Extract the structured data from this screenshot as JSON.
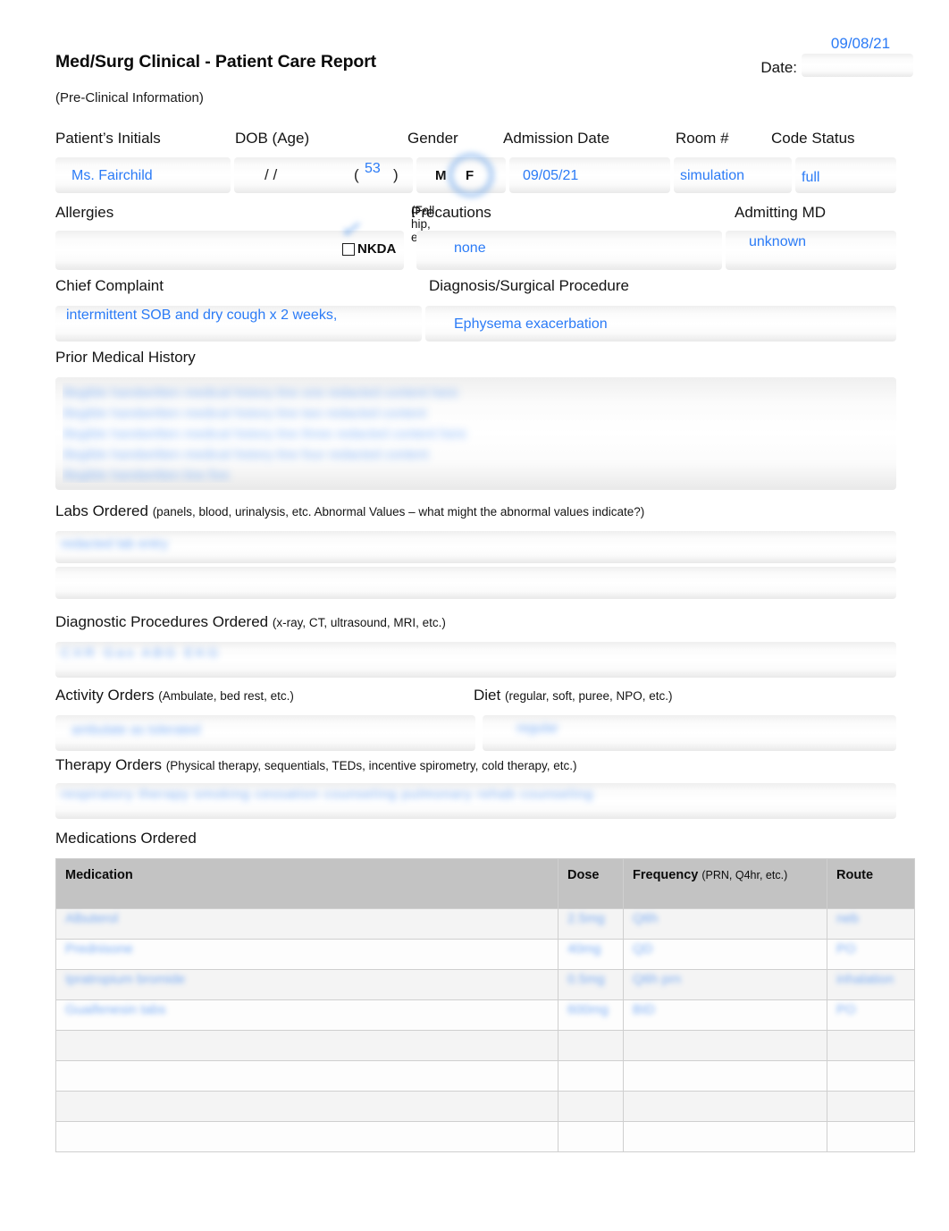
{
  "header": {
    "title": "Med/Surg Clinical - Patient Care Report",
    "subtitle": "(Pre-Clinical Information)",
    "date_label": "Date:",
    "date_value": "09/08/21"
  },
  "colors": {
    "handwriting_blue": "#2b7bf6",
    "table_header_gray": "#c3c3c3",
    "text_black": "#111111"
  },
  "identity": {
    "labels": {
      "initials": "Patient’s Initials",
      "dob": "DOB (Age)",
      "gender": "Gender",
      "admission": "Admission Date",
      "room": "Room #",
      "code_status": "Code Status"
    },
    "initials_value": "Ms. Fairchild",
    "dob_value": "/        /",
    "age_open_paren": "(",
    "age_value": "53",
    "age_close_paren": ")",
    "gender_options": [
      "M",
      "F"
    ],
    "gender_selected": "F",
    "admission_value": "09/05/21",
    "room_value": "simulation",
    "code_status_value": "full"
  },
  "allergies_row": {
    "labels": {
      "allergies": "Allergies",
      "precautions": "Precautions",
      "precautions_hint": "(Fall, hip, etc.)",
      "admitting_md": "Admitting MD"
    },
    "allergies_value": "",
    "nkda_label": "NKDA",
    "nkda_checked": true,
    "precautions_value": "none",
    "admitting_md_value": "unknown"
  },
  "complaint_row": {
    "labels": {
      "chief_complaint": "Chief Complaint",
      "diagnosis": "Diagnosis/Surgical Procedure"
    },
    "chief_complaint_value": "intermittent SOB and dry cough x 2 weeks,",
    "diagnosis_value": "Ephysema exacerbation"
  },
  "sections": [
    {
      "name": "prior-medical-history",
      "label": "Prior Medical History",
      "hint": "",
      "redacted": true,
      "lines": [
        "illegible handwritten medical history line one redacted content here",
        "illegible handwritten medical history line two redacted content",
        "illegible handwritten medical history line three redacted content here",
        "illegible handwritten medical history line four redacted content",
        "illegible handwritten line five"
      ]
    },
    {
      "name": "labs-ordered",
      "label": "Labs Ordered",
      "hint": "(panels, blood, urinalysis, etc. Abnormal Values  –  what might the abnormal values indicate?)",
      "redacted": true,
      "lines": [
        "redacted lab entry",
        ""
      ]
    },
    {
      "name": "diagnostic-procedures-ordered",
      "label": "Diagnostic Procedures Ordered",
      "hint": "(x-ray, CT, ultrasound, MRI, etc.)",
      "redacted": true,
      "lines": [
        "CXR  Gas  ABG  EKG"
      ]
    },
    {
      "name": "therapy-orders",
      "label": "Therapy Orders",
      "hint": "(Physical therapy, sequentials, TEDs, incentive spirometry, cold therapy, etc.)",
      "redacted": true,
      "lines": [
        "respiratory therapy  smoking cessation counseling  pulmonary rehab counseling"
      ]
    }
  ],
  "activity_diet": {
    "activity_label": "Activity Orders",
    "activity_hint": "(Ambulate, bed rest, etc.)",
    "activity_value_redacted": "ambulate as tolerated",
    "diet_label": "Diet",
    "diet_hint": "(regular, soft, puree, NPO, etc.)",
    "diet_value_redacted": "regular"
  },
  "medications": {
    "section_label": "Medications Ordered",
    "columns": [
      {
        "key": "medication",
        "label": "Medication",
        "hint": ""
      },
      {
        "key": "dose",
        "label": "Dose",
        "hint": ""
      },
      {
        "key": "frequency",
        "label": "Frequency",
        "hint": "(PRN, Q4hr, etc.)"
      },
      {
        "key": "route",
        "label": "Route",
        "hint": ""
      }
    ],
    "rows": [
      {
        "medication": "Albuterol",
        "dose": "2.5mg",
        "frequency": "Q6h",
        "route": "neb",
        "redacted": true
      },
      {
        "medication": "Prednisone",
        "dose": "40mg",
        "frequency": "QD",
        "route": "PO",
        "redacted": true
      },
      {
        "medication": "Ipratropium bromide",
        "dose": "0.5mg",
        "frequency": "Q6h  prn",
        "route": "inhalation",
        "redacted": true
      },
      {
        "medication": "Guaifenesin tabs",
        "dose": "600mg",
        "frequency": "BID",
        "route": "PO",
        "redacted": true
      },
      {
        "medication": "",
        "dose": "",
        "frequency": "",
        "route": "",
        "redacted": false
      },
      {
        "medication": "",
        "dose": "",
        "frequency": "",
        "route": "",
        "redacted": false
      },
      {
        "medication": "",
        "dose": "",
        "frequency": "",
        "route": "",
        "redacted": false
      },
      {
        "medication": "",
        "dose": "",
        "frequency": "",
        "route": "",
        "redacted": false
      }
    ]
  }
}
